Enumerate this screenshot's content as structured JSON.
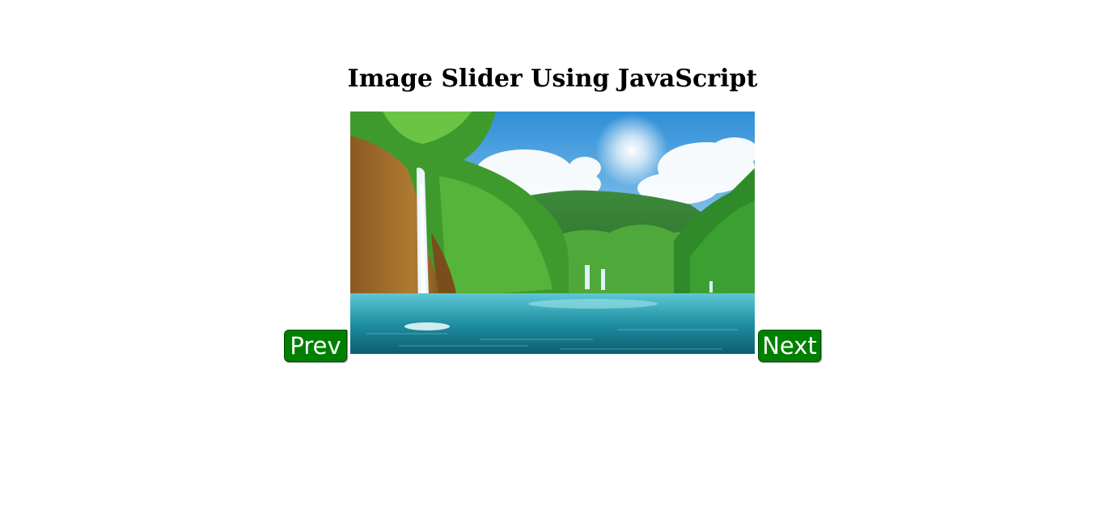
{
  "page": {
    "title": "Image Slider Using JavaScript"
  },
  "slider": {
    "prev_label": "Prev",
    "next_label": "Next",
    "current_slide": {
      "subject": "waterfall lake landscape"
    }
  },
  "colors": {
    "button_bg": "#008000",
    "button_text": "#ffffff",
    "page_bg": "#ffffff"
  }
}
